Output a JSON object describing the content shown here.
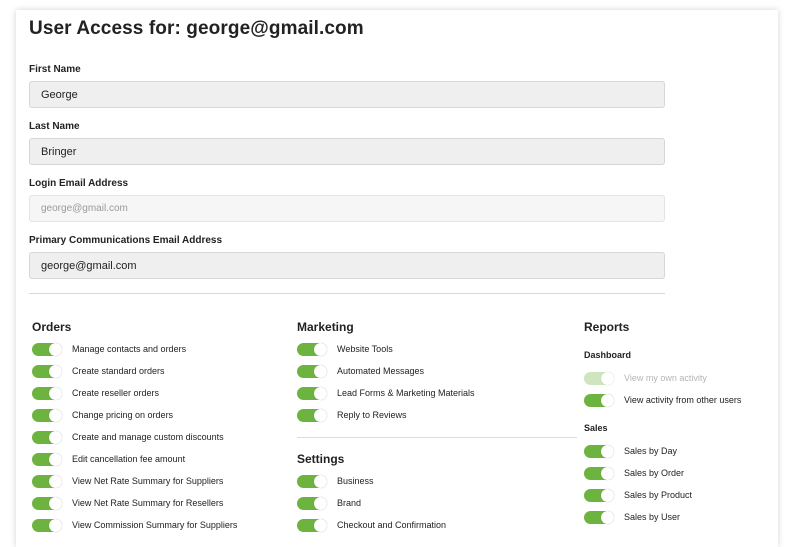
{
  "page": {
    "title": "User Access for: george@gmail.com"
  },
  "fields": [
    {
      "label": "First Name",
      "value": "George",
      "disabled": false
    },
    {
      "label": "Last Name",
      "value": "Bringer",
      "disabled": false
    },
    {
      "label": "Login Email Address",
      "value": "george@gmail.com",
      "disabled": true
    },
    {
      "label": "Primary Communications Email Address",
      "value": "george@gmail.com",
      "disabled": false
    }
  ],
  "orders": {
    "title": "Orders",
    "items": [
      {
        "label": "Manage contacts and orders",
        "on": true
      },
      {
        "label": "Create standard orders",
        "on": true
      },
      {
        "label": "Create reseller orders",
        "on": true
      },
      {
        "label": "Change pricing on orders",
        "on": true
      },
      {
        "label": "Create and manage custom discounts",
        "on": true
      },
      {
        "label": "Edit cancellation fee amount",
        "on": true
      },
      {
        "label": "View Net Rate Summary for Suppliers",
        "on": true
      },
      {
        "label": "View Net Rate Summary for Resellers",
        "on": true
      },
      {
        "label": "View Commission Summary for Suppliers",
        "on": true
      }
    ]
  },
  "marketing": {
    "title": "Marketing",
    "items": [
      {
        "label": "Website Tools",
        "on": true
      },
      {
        "label": "Automated Messages",
        "on": true
      },
      {
        "label": "Lead Forms & Marketing Materials",
        "on": true
      },
      {
        "label": "Reply to Reviews",
        "on": true
      }
    ]
  },
  "settings": {
    "title": "Settings",
    "items": [
      {
        "label": "Business",
        "on": true
      },
      {
        "label": "Brand",
        "on": true
      },
      {
        "label": "Checkout and Confirmation",
        "on": true
      }
    ]
  },
  "reports": {
    "title": "Reports",
    "dashboard": {
      "title": "Dashboard",
      "items": [
        {
          "label": "View my own activity",
          "on": true,
          "disabled": true
        },
        {
          "label": "View activity from other users",
          "on": true,
          "disabled": false
        }
      ]
    },
    "sales": {
      "title": "Sales",
      "items": [
        {
          "label": "Sales by Day",
          "on": true
        },
        {
          "label": "Sales by Order",
          "on": true
        },
        {
          "label": "Sales by Product",
          "on": true
        },
        {
          "label": "Sales by User",
          "on": true
        }
      ]
    }
  },
  "colors": {
    "toggle_on": "#6cb33f",
    "toggle_disabled": "#cfe5bf"
  }
}
